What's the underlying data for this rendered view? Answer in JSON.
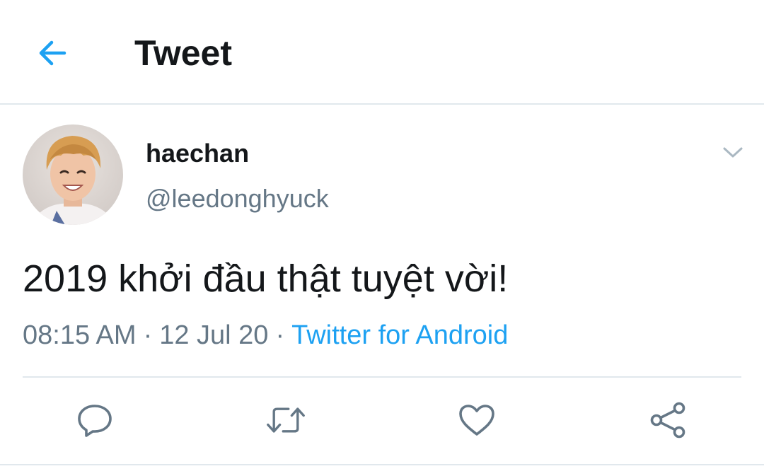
{
  "header": {
    "title": "Tweet",
    "back_icon": "arrow-left-icon",
    "accent_color": "#1da1f2"
  },
  "tweet": {
    "author": {
      "display_name": "haechan",
      "handle": "@leedonghyuck",
      "avatar_icon": "profile-photo"
    },
    "text": "2019 khởi đầu thật tuyệt vời!",
    "time": "08:15 AM",
    "separator": "·",
    "date": "12 Jul 20",
    "source": "Twitter for Android",
    "menu_icon": "chevron-down-icon"
  },
  "actions": [
    {
      "icon": "reply-icon"
    },
    {
      "icon": "retweet-icon"
    },
    {
      "icon": "like-icon"
    },
    {
      "icon": "share-icon"
    }
  ],
  "colors": {
    "text_primary": "#14171a",
    "text_secondary": "#657786",
    "link": "#1da1f2",
    "divider": "#e1e8ed"
  }
}
